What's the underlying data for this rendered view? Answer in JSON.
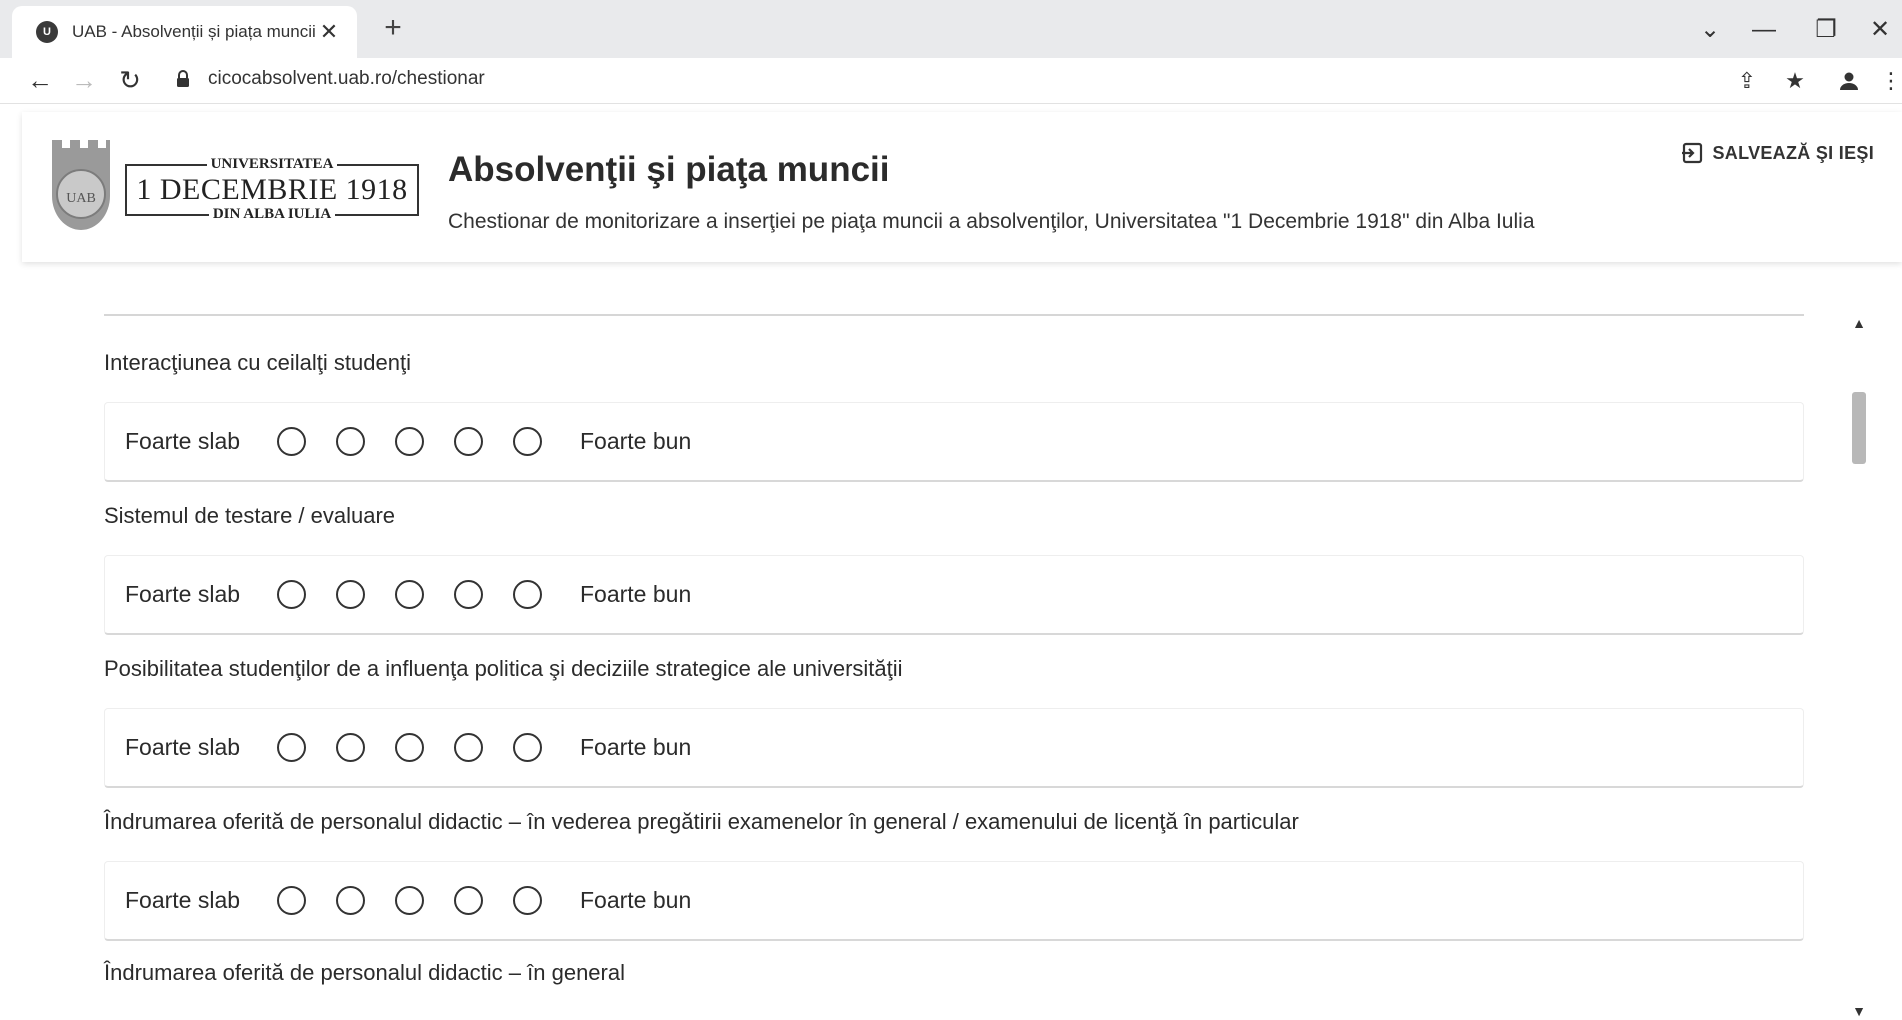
{
  "browser": {
    "tab_title": "UAB - Absolvenții și piața muncii",
    "tab_close": "✕",
    "new_tab": "+",
    "url": "cicocabsolvent.uab.ro/chestionar",
    "controls": {
      "back": "←",
      "forward": "→",
      "reload": "↻",
      "tab_search": "⌄",
      "minimize": "—",
      "restore": "❐",
      "close": "✕"
    },
    "toolbar_icons": {
      "share": "⇪",
      "bookmark": "★",
      "profile": "👤",
      "menu": "⋮"
    }
  },
  "header": {
    "logo_line1": "UNIVERSITATEA",
    "logo_line2": "1 DECEMBRIE 1918",
    "logo_line3": "DIN ALBA IULIA",
    "logo_seal_text": "UAB",
    "title": "Absolvenţii şi piaţa muncii",
    "subtitle": "Chestionar de monitorizare a inserţiei pe piaţa muncii a absolvenţilor, Universitatea \"1 Decembrie 1918\" din Alba Iulia",
    "save_exit_label": "SALVEAZĂ ŞI IEŞI"
  },
  "scale": {
    "low_label": "Foarte slab",
    "high_label": "Foarte bun"
  },
  "questions": [
    {
      "label": "Interacţiunea cu ceilalţi studenţi"
    },
    {
      "label": "Sistemul de testare / evaluare"
    },
    {
      "label": "Posibilitatea studenţilor de a influenţa politica şi deciziile strategice ale universităţii"
    },
    {
      "label": "Îndrumarea oferită de personalul didactic – în vederea pregătirii examenelor în general / examenului de licenţă în particular"
    },
    {
      "label": "Îndrumarea oferită de personalul didactic – în general"
    }
  ],
  "scrollbar": {
    "up": "▲",
    "down": "▼"
  }
}
